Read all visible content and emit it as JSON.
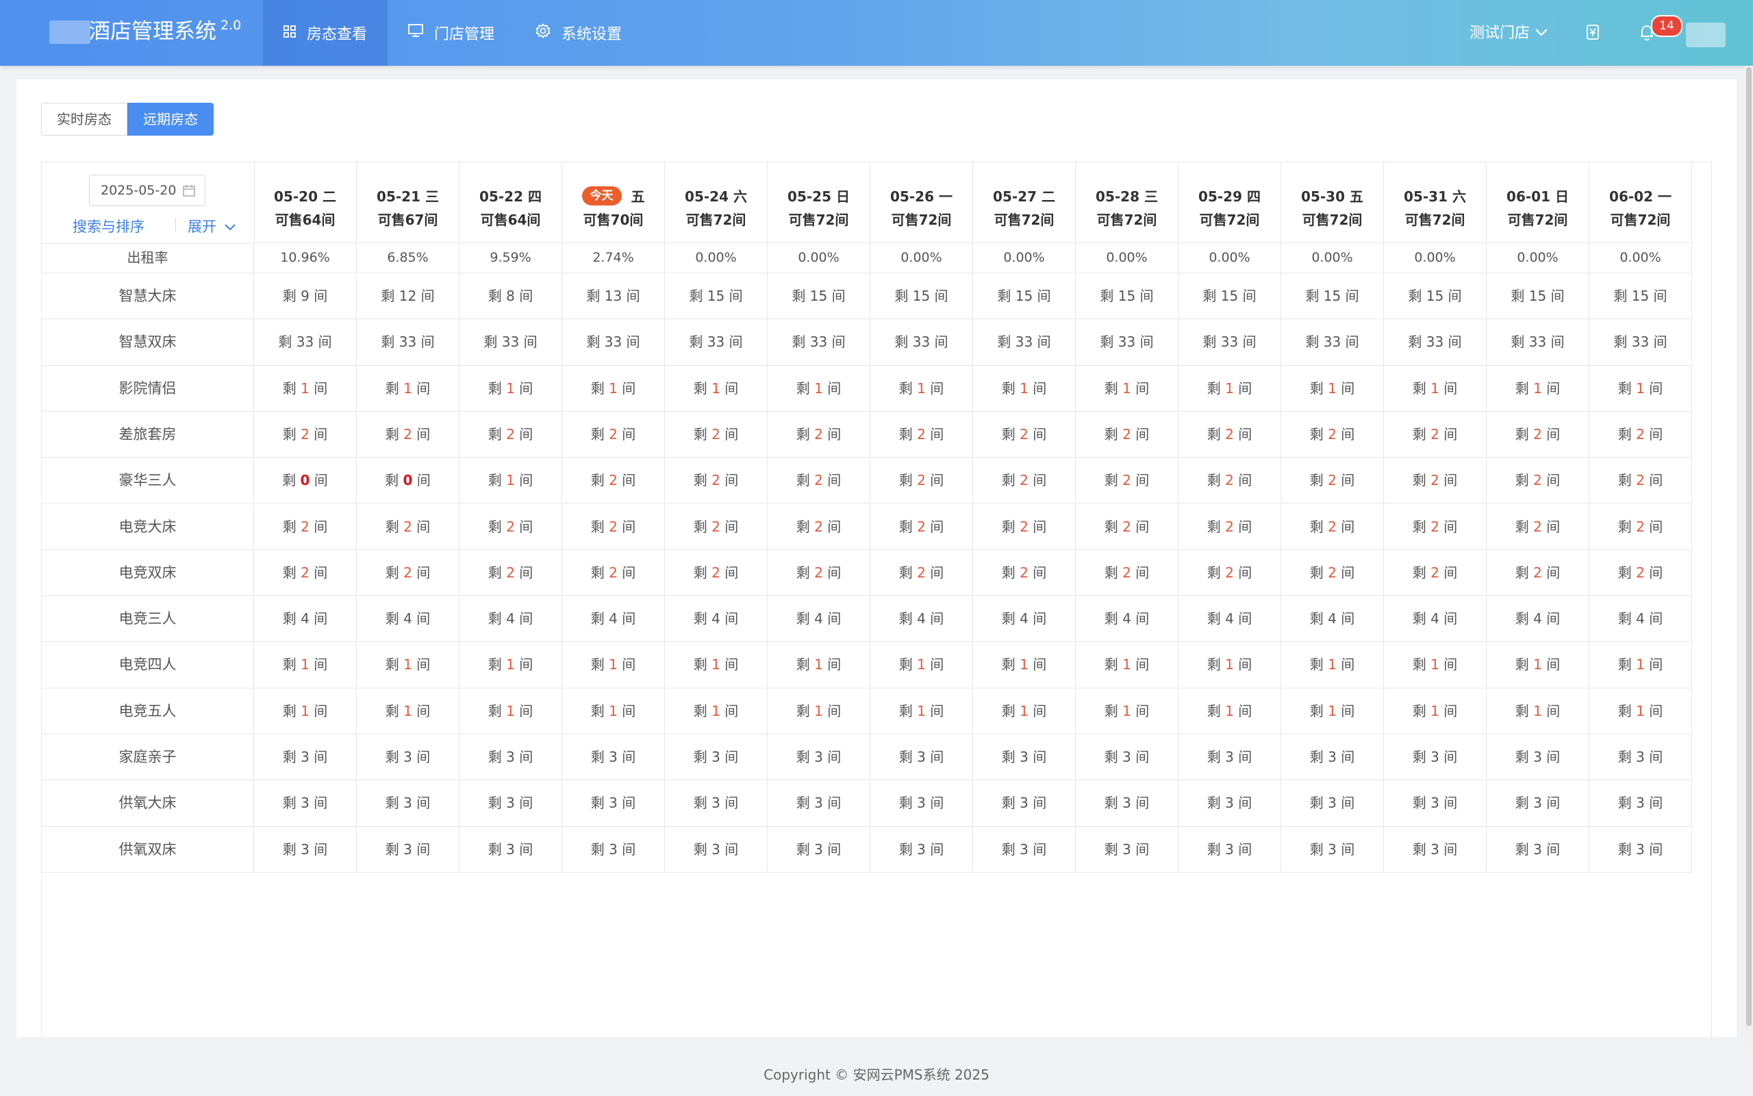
{
  "header": {
    "app_title": "酒店管理系统",
    "version": "2.0",
    "nav": [
      {
        "label": "房态查看",
        "icon": "grid-icon",
        "active": true
      },
      {
        "label": "门店管理",
        "icon": "monitor-icon",
        "active": false
      },
      {
        "label": "系统设置",
        "icon": "gear-icon",
        "active": false
      }
    ],
    "store": "测试门店",
    "notification_count": "14"
  },
  "tabs": [
    {
      "label": "实时房态",
      "active": false
    },
    {
      "label": "远期房态",
      "active": true
    }
  ],
  "filters": {
    "date": "2025-05-20",
    "search_sort": "搜索与排序",
    "expand": "展开"
  },
  "today_label": "今天",
  "prefix": "剩",
  "suffix": "间",
  "occupancy_label": "出租率",
  "dates": [
    {
      "date": "05-20 二",
      "available": "可售64间",
      "occupancy": "10.96%"
    },
    {
      "date": "05-21 三",
      "available": "可售67间",
      "occupancy": "6.85%"
    },
    {
      "date": "05-22 四",
      "available": "可售64间",
      "occupancy": "9.59%"
    },
    {
      "date": "五",
      "today": true,
      "available": "可售70间",
      "occupancy": "2.74%"
    },
    {
      "date": "05-24 六",
      "available": "可售72间",
      "occupancy": "0.00%"
    },
    {
      "date": "05-25 日",
      "available": "可售72间",
      "occupancy": "0.00%"
    },
    {
      "date": "05-26 一",
      "available": "可售72间",
      "occupancy": "0.00%"
    },
    {
      "date": "05-27 二",
      "available": "可售72间",
      "occupancy": "0.00%"
    },
    {
      "date": "05-28 三",
      "available": "可售72间",
      "occupancy": "0.00%"
    },
    {
      "date": "05-29 四",
      "available": "可售72间",
      "occupancy": "0.00%"
    },
    {
      "date": "05-30 五",
      "available": "可售72间",
      "occupancy": "0.00%"
    },
    {
      "date": "05-31 六",
      "available": "可售72间",
      "occupancy": "0.00%"
    },
    {
      "date": "06-01 日",
      "available": "可售72间",
      "occupancy": "0.00%"
    },
    {
      "date": "06-02 一",
      "available": "可售72间",
      "occupancy": "0.00%"
    }
  ],
  "rooms": [
    {
      "name": "智慧大床",
      "counts": [
        9,
        12,
        8,
        13,
        15,
        15,
        15,
        15,
        15,
        15,
        15,
        15,
        15,
        15
      ]
    },
    {
      "name": "智慧双床",
      "counts": [
        33,
        33,
        33,
        33,
        33,
        33,
        33,
        33,
        33,
        33,
        33,
        33,
        33,
        33
      ]
    },
    {
      "name": "影院情侣",
      "counts": [
        1,
        1,
        1,
        1,
        1,
        1,
        1,
        1,
        1,
        1,
        1,
        1,
        1,
        1
      ]
    },
    {
      "name": "差旅套房",
      "counts": [
        2,
        2,
        2,
        2,
        2,
        2,
        2,
        2,
        2,
        2,
        2,
        2,
        2,
        2
      ]
    },
    {
      "name": "豪华三人",
      "counts": [
        0,
        0,
        1,
        2,
        2,
        2,
        2,
        2,
        2,
        2,
        2,
        2,
        2,
        2
      ]
    },
    {
      "name": "电竞大床",
      "counts": [
        2,
        2,
        2,
        2,
        2,
        2,
        2,
        2,
        2,
        2,
        2,
        2,
        2,
        2
      ]
    },
    {
      "name": "电竞双床",
      "counts": [
        2,
        2,
        2,
        2,
        2,
        2,
        2,
        2,
        2,
        2,
        2,
        2,
        2,
        2
      ]
    },
    {
      "name": "电竞三人",
      "counts": [
        4,
        4,
        4,
        4,
        4,
        4,
        4,
        4,
        4,
        4,
        4,
        4,
        4,
        4
      ]
    },
    {
      "name": "电竞四人",
      "counts": [
        1,
        1,
        1,
        1,
        1,
        1,
        1,
        1,
        1,
        1,
        1,
        1,
        1,
        1
      ]
    },
    {
      "name": "电竞五人",
      "counts": [
        1,
        1,
        1,
        1,
        1,
        1,
        1,
        1,
        1,
        1,
        1,
        1,
        1,
        1
      ]
    },
    {
      "name": "家庭亲子",
      "counts": [
        3,
        3,
        3,
        3,
        3,
        3,
        3,
        3,
        3,
        3,
        3,
        3,
        3,
        3
      ]
    },
    {
      "name": "供氧大床",
      "counts": [
        3,
        3,
        3,
        3,
        3,
        3,
        3,
        3,
        3,
        3,
        3,
        3,
        3,
        3
      ]
    },
    {
      "name": "供氧双床",
      "counts": [
        3,
        3,
        3,
        3,
        3,
        3,
        3,
        3,
        3,
        3,
        3,
        3,
        3,
        3
      ]
    }
  ],
  "footer": "Copyright © 安网云PMS系统 2025"
}
